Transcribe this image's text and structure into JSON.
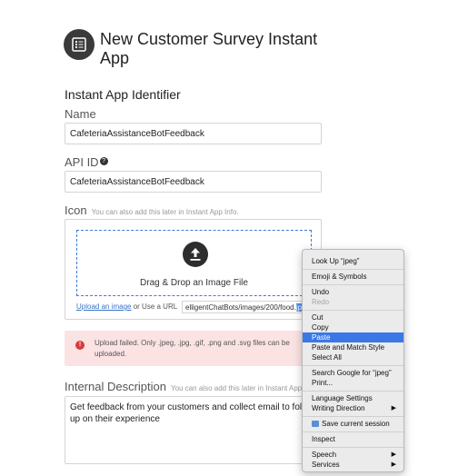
{
  "header": {
    "title": "New Customer Survey Instant App",
    "icon": "list-form-icon"
  },
  "identifier": {
    "section_title": "Instant App Identifier",
    "name_label": "Name",
    "name_value": "CafeteriaAssistanceBotFeedback",
    "api_id_label": "API ID",
    "api_id_value": "CafeteriaAssistanceBotFeedback"
  },
  "icon_section": {
    "label": "Icon",
    "helper": "You can also add this later in Instant App Info.",
    "drop_text": "Drag & Drop an Image File",
    "upload_link": "Upload an image",
    "or_url": "or Use a URL",
    "url_value": "elligentChatBots/images/200/food.",
    "url_selected": "jpeg"
  },
  "error": {
    "message": "Upload failed. Only .jpeg, .jpg, .gif, .png and .svg files can be uploaded."
  },
  "description": {
    "label": "Internal Description",
    "helper": "You can also add this later in Instant App In",
    "value": "Get feedback from your customers and collect email to follow up on their experience"
  },
  "context_menu": {
    "look_up": "Look Up “jpeg”",
    "emoji": "Emoji & Symbols",
    "undo": "Undo",
    "redo": "Redo",
    "cut": "Cut",
    "copy": "Copy",
    "paste": "Paste",
    "paste_match": "Paste and Match Style",
    "select_all": "Select All",
    "search_google": "Search Google for “jpeg”",
    "print": "Print...",
    "language_settings": "Language Settings",
    "writing_direction": "Writing Direction",
    "save_session": "Save current session",
    "inspect": "Inspect",
    "speech": "Speech",
    "services": "Services",
    "selected_item": "Paste"
  },
  "colors": {
    "accent": "#3b78e6",
    "error_bg": "#fbe3e3",
    "error_icon": "#d93a3a",
    "dropzone_border": "#3d7bd8"
  }
}
